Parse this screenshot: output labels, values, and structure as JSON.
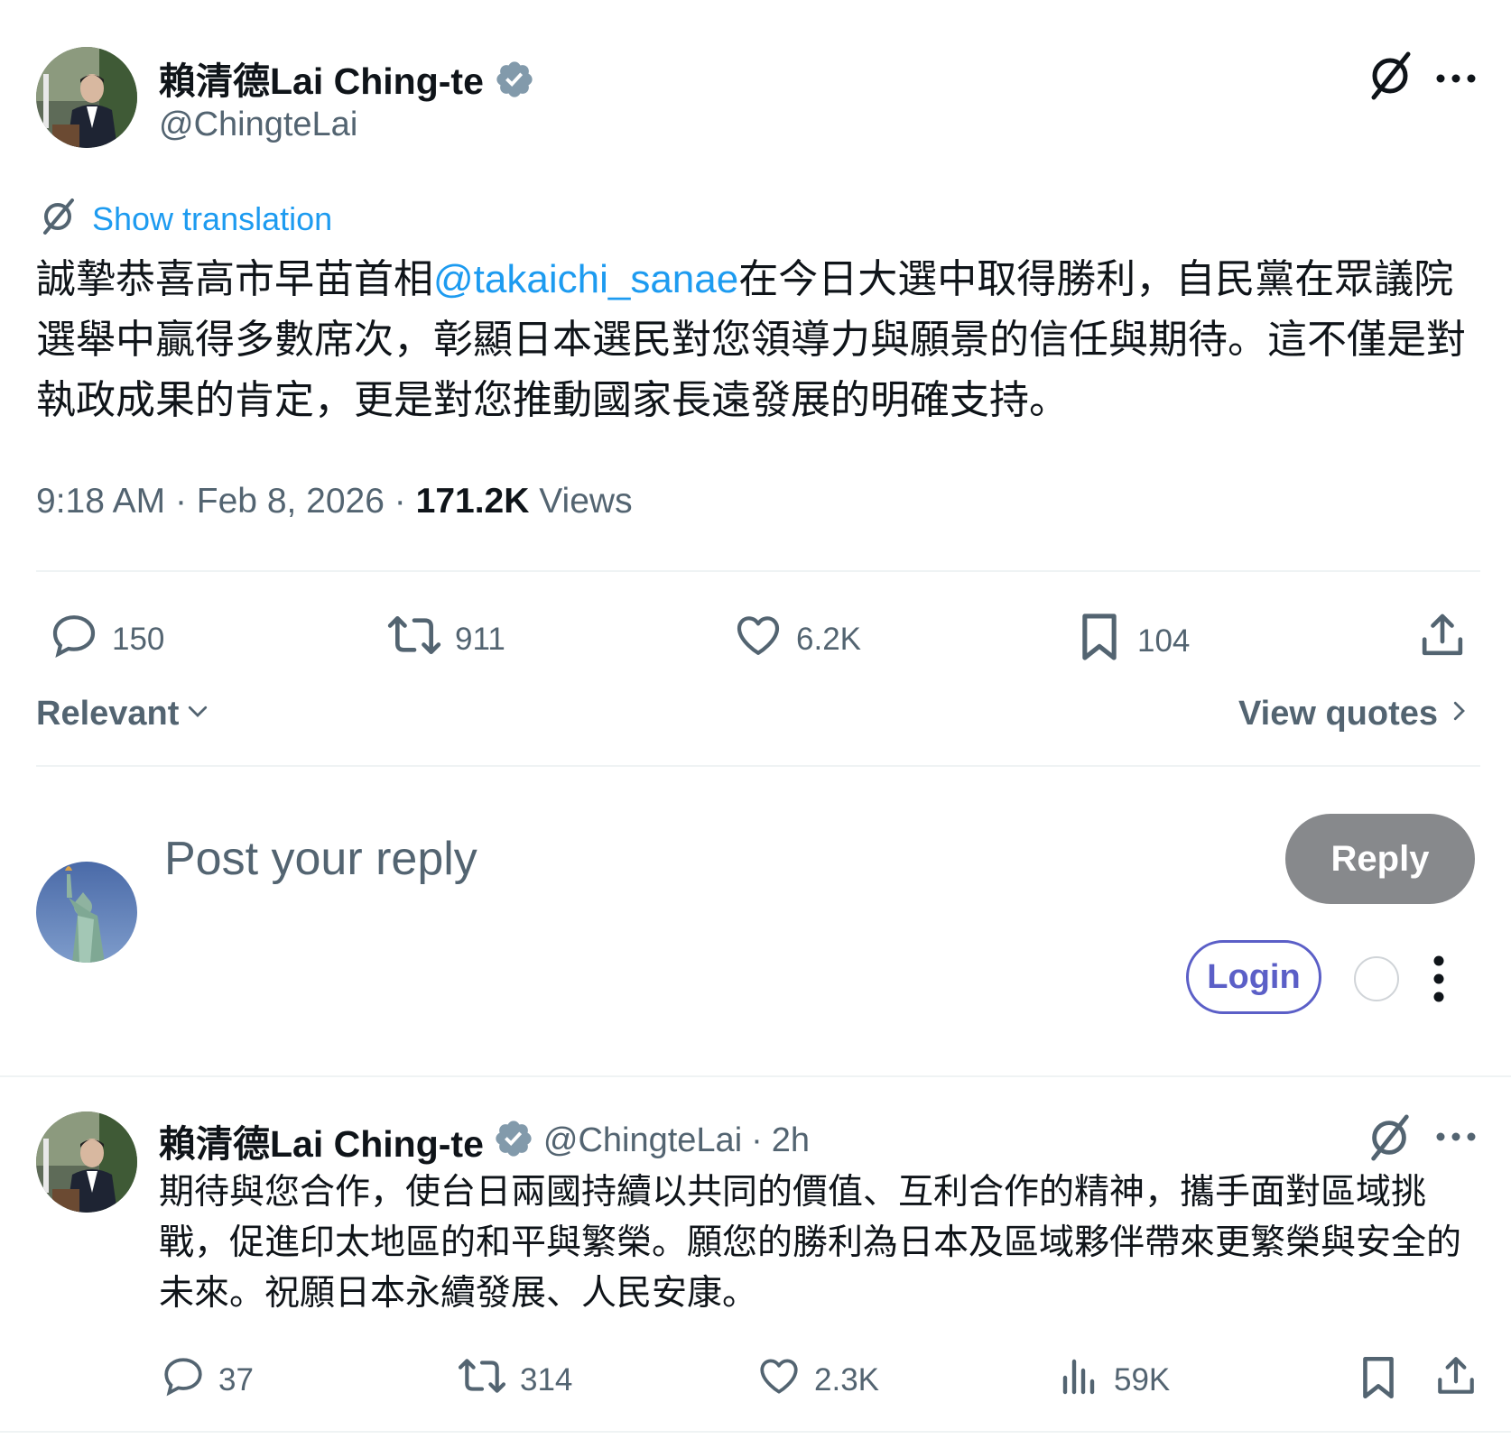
{
  "main_post": {
    "author": {
      "name": "賴清德Lai Ching-te",
      "handle": "@ChingteLai",
      "verified": true,
      "avatar": "person-at-podium-photo"
    },
    "show_translation": "Show translation",
    "text_before_mention": "誠摯恭喜高市早苗首相",
    "mention": "@takaichi_sanae",
    "text_after_mention": "在今日大選中取得勝利，自民黨在眾議院選舉中贏得多數席次，彰顯日本選民對您領導力與願景的信任與期待。這不僅是對執政成果的肯定，更是對您推動國家長遠發展的明確支持。",
    "time": "9:18 AM",
    "date": "Feb 8, 2026",
    "separator": "·",
    "views_count": "171.2K",
    "views_label": "Views",
    "stats": {
      "replies": "150",
      "reposts": "911",
      "likes": "6.2K",
      "bookmarks": "104"
    }
  },
  "sort": {
    "label": "Relevant",
    "view_quotes": "View quotes"
  },
  "composer": {
    "placeholder": "Post your reply",
    "reply_button": "Reply",
    "login_button": "Login",
    "avatar": "statue-of-liberty-photo"
  },
  "reply_post": {
    "author": {
      "name": "賴清德Lai Ching-te",
      "handle": "@ChingteLai",
      "time": "2h",
      "verified": true
    },
    "text": "期待與您合作，使台日兩國持續以共同的價值、互利合作的精神，攜手面對區域挑戰，促進印太地區的和平與繁榮。願您的勝利為日本及區域夥伴帶來更繁榮與安全的未來。祝願日本永續發展、人民安康。",
    "stats": {
      "replies": "37",
      "reposts": "314",
      "likes": "2.3K",
      "views": "59K"
    }
  },
  "colors": {
    "text": "#0f1419",
    "secondary": "#536471",
    "link": "#1d9bf0",
    "verified": "#829aab",
    "reply_button_bg": "#87898c",
    "login_border": "#5b5fc7",
    "divider": "#eff3f4"
  },
  "icons": {
    "translate": "translate-slash-icon",
    "more": "more-dots-icon",
    "reply": "comment-icon",
    "repost": "repost-icon",
    "like": "heart-icon",
    "bookmark": "bookmark-icon",
    "share": "share-icon",
    "views": "analytics-icon"
  }
}
